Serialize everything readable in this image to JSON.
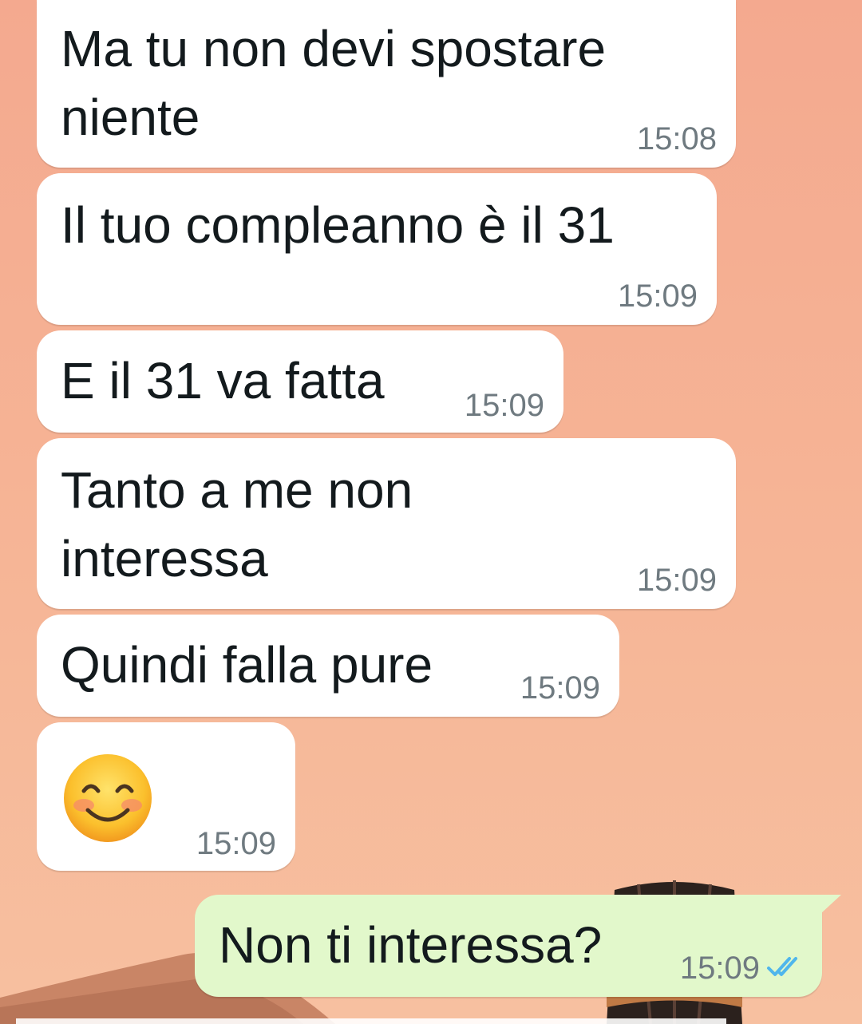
{
  "messages": [
    {
      "direction": "incoming",
      "text": "Ma tu non devi spostare\nniente",
      "time": "15:08"
    },
    {
      "direction": "incoming",
      "text": "Il tuo compleanno è il 31",
      "time": "15:09"
    },
    {
      "direction": "incoming",
      "text": "E il 31 va fatta",
      "time": "15:09"
    },
    {
      "direction": "incoming",
      "text": "Tanto a me non\ninteressa",
      "time": "15:09"
    },
    {
      "direction": "incoming",
      "text": "Quindi falla pure",
      "time": "15:09"
    },
    {
      "direction": "incoming",
      "emoji": "smiling-face-with-smiling-eyes",
      "time": "15:09"
    },
    {
      "direction": "outgoing",
      "text": "Non ti interessa?",
      "time": "15:09",
      "status": "read"
    }
  ],
  "colors": {
    "incoming_bubble": "#ffffff",
    "outgoing_bubble": "#e2f8cb",
    "text": "#131a1d",
    "timestamp": "#6f7a80",
    "read_ticks": "#4fb6ec"
  },
  "wallpaper": {
    "theme": "desert-sunset-hot-air-balloon"
  }
}
